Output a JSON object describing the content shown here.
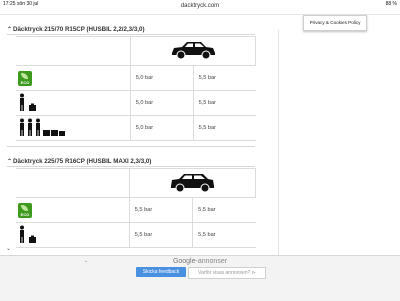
{
  "status_bar": {
    "time": "17:25",
    "date": "sön 30 jul",
    "battery": "88 %"
  },
  "browser": {
    "url": "dacktryck.com"
  },
  "privacy": {
    "label": "Privacy & Cookies Policy"
  },
  "sections": [
    {
      "title": "Däcktryck 215/70 R15CP (HUSBIL 2,2/2,3/3,0)",
      "rows": [
        {
          "icon": "eco-icon",
          "icon_text": "ECO",
          "front": "5,0 bar",
          "rear": "5,5 bar"
        },
        {
          "icon": "one-person-luggage-icon",
          "front": "5,0 bar",
          "rear": "5,5 bar"
        },
        {
          "icon": "three-people-luggage-icon",
          "front": "5,0 bar",
          "rear": "5,5 bar"
        }
      ]
    },
    {
      "title": "Däcktryck 225/75 R16CP (HUSBIL MAXI 2,3/3,0)",
      "rows": [
        {
          "icon": "eco-icon",
          "icon_text": "ECO",
          "front": "5,5 bar",
          "rear": "5,5 bar"
        },
        {
          "icon": "one-person-luggage-icon",
          "front": "5,5 bar",
          "rear": "5,5 bar"
        }
      ]
    }
  ],
  "ad": {
    "brand": "Google",
    "label": "annonser",
    "feedback_button": "Skicka feedback",
    "why_button": "Varför visas annonsen?"
  },
  "colors": {
    "eco_green": "#3d9a1f",
    "feedback_blue": "#4a90e2"
  }
}
